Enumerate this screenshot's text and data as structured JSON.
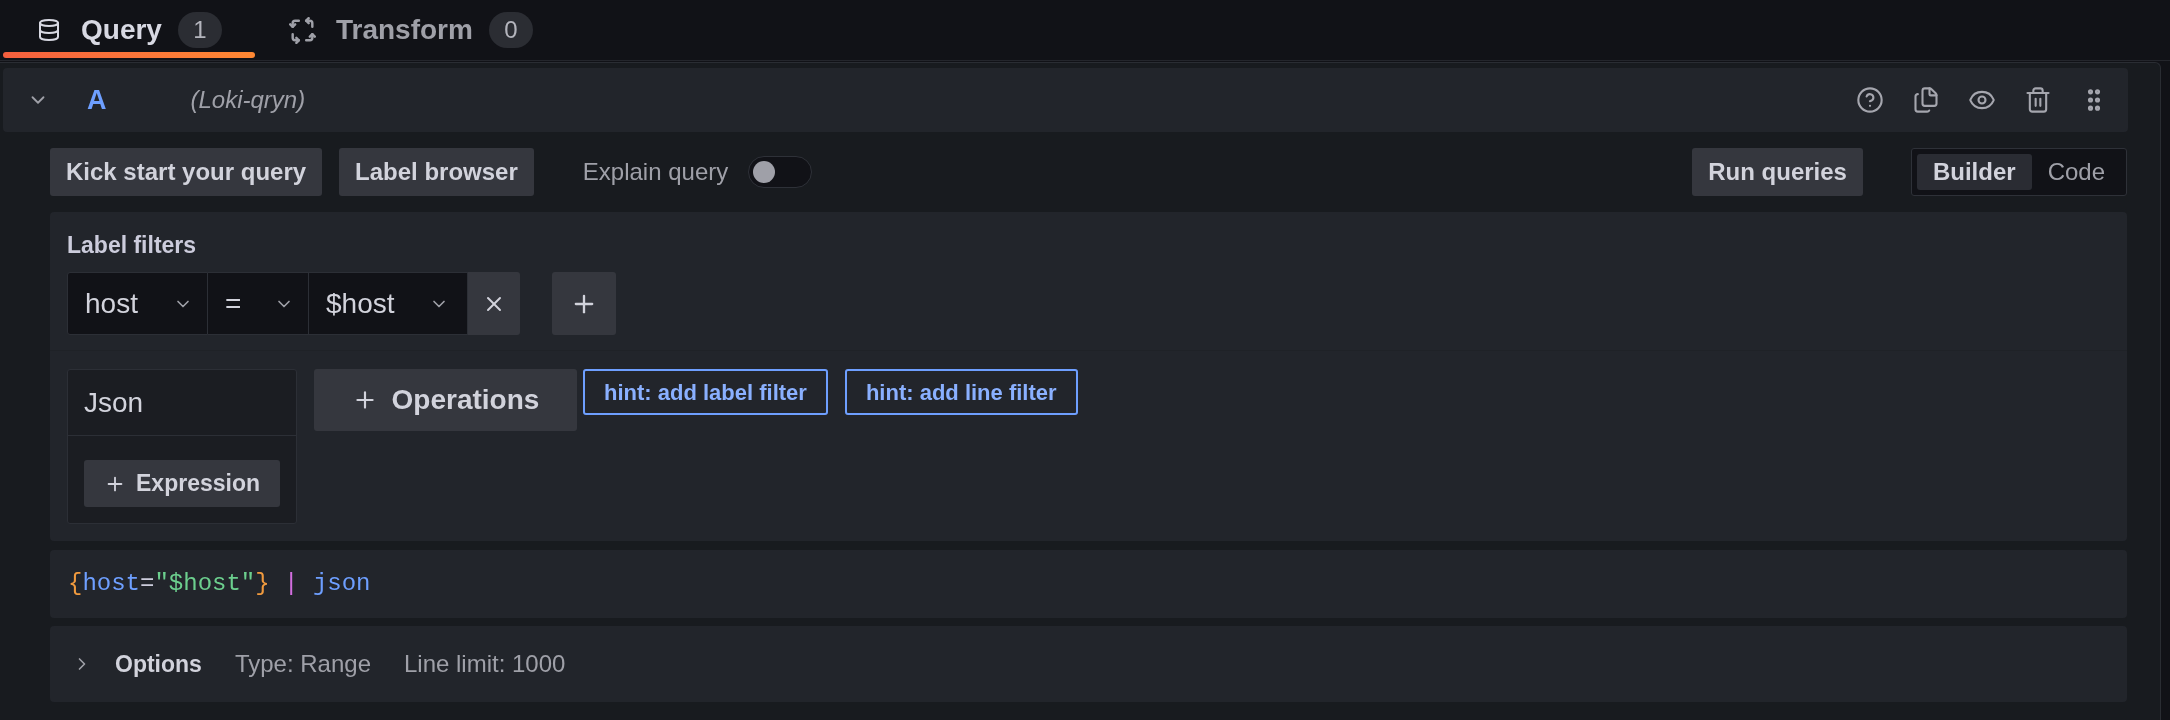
{
  "tabs": [
    {
      "kind": "query",
      "label": "Query",
      "count": "1",
      "selected": true
    },
    {
      "kind": "transform",
      "label": "Transform",
      "count": "0",
      "selected": false
    }
  ],
  "query": {
    "expanded": true,
    "ref_id": "A",
    "datasource": "(Loki-qryn)"
  },
  "toolbar": {
    "buttons": [
      "Kick start your query",
      "Label browser"
    ],
    "explain": {
      "label": "Explain query",
      "on": false
    },
    "run_button": "Run queries",
    "modes": [
      {
        "label": "Builder",
        "selected": true
      },
      {
        "label": "Code",
        "selected": false
      }
    ]
  },
  "label_filters": {
    "title": "Label filters",
    "filters": [
      {
        "label": "host",
        "operator": "=",
        "value": "$host"
      }
    ]
  },
  "operations": {
    "items": [
      {
        "name": "Json",
        "button": "Expression"
      }
    ],
    "add_button": "Operations",
    "hints": [
      "hint: add label filter",
      "hint: add line filter"
    ]
  },
  "query_preview": [
    {
      "kind": "brace",
      "text": "{"
    },
    {
      "kind": "label",
      "text": "host"
    },
    {
      "kind": "operator",
      "text": "="
    },
    {
      "kind": "string",
      "text": "\"$host\""
    },
    {
      "kind": "brace",
      "text": "}"
    },
    {
      "kind": "pipe",
      "text": " | "
    },
    {
      "kind": "parser",
      "text": "json"
    }
  ],
  "options": {
    "expanded": false,
    "title": "Options",
    "summary": [
      "Type: Range",
      "Line limit: 1000"
    ]
  }
}
